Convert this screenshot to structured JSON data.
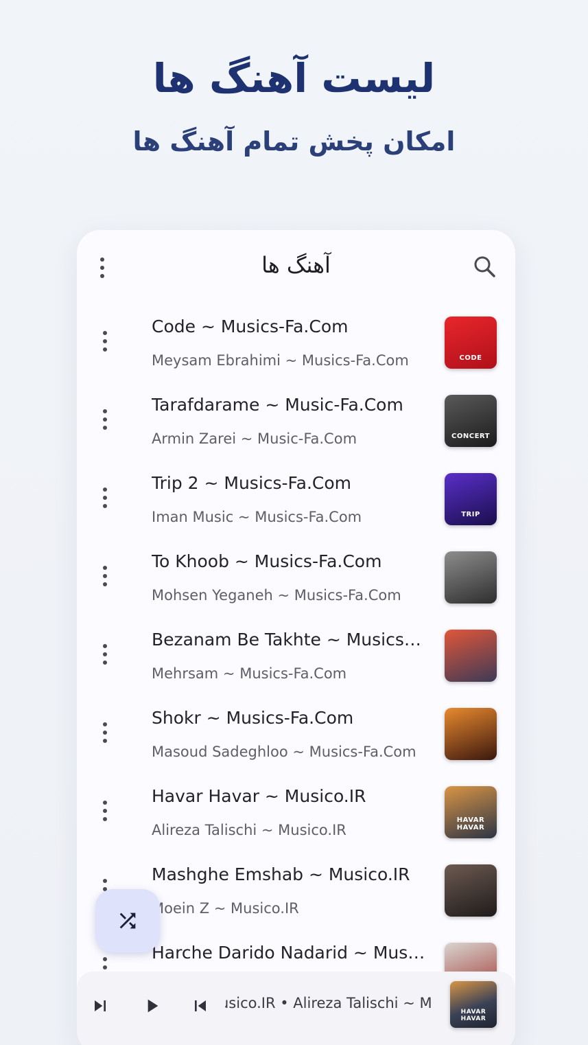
{
  "promo": {
    "title": "لیست آهنگ ها",
    "subtitle": "امکان پخش تمام آهنگ ها"
  },
  "appbar": {
    "title": "آهنگ ها",
    "menu_icon": "more-vert-icon",
    "search_icon": "search-icon"
  },
  "songs": [
    {
      "title": "Code ~ Musics-Fa.Com",
      "artist": "Meysam Ebrahimi ~ Musics-Fa.Com",
      "art_label": "CODE",
      "art_colors": [
        "#e8262b",
        "#b0101a"
      ]
    },
    {
      "title": "Tarafdarame ~ Music-Fa.Com",
      "artist": "Armin Zarei ~ Music-Fa.Com",
      "art_label": "CONCERT",
      "art_colors": [
        "#5a5a5a",
        "#1b1b1b"
      ]
    },
    {
      "title": "Trip 2 ~ Musics-Fa.Com",
      "artist": "Iman Music ~ Musics-Fa.Com",
      "art_label": "TRIP",
      "art_colors": [
        "#5a2ec9",
        "#1a0f4d"
      ]
    },
    {
      "title": "To Khoob ~ Musics-Fa.Com",
      "artist": "Mohsen Yeganeh ~ Musics-Fa.Com",
      "art_label": "",
      "art_colors": [
        "#8d8d8d",
        "#2e2e2e"
      ]
    },
    {
      "title": "Bezanam Be Takhte ~ Musics-Fa.Com",
      "artist": "Mehrsam ~ Musics-Fa.Com",
      "art_label": "",
      "art_colors": [
        "#e0563a",
        "#3d3a56"
      ]
    },
    {
      "title": "Shokr ~ Musics-Fa.Com",
      "artist": "Masoud Sadeghloo ~ Musics-Fa.Com",
      "art_label": "",
      "art_colors": [
        "#e88a2f",
        "#3b170e"
      ]
    },
    {
      "title": "Havar Havar ~ Musico.IR",
      "artist": "Alireza Talischi ~ Musico.IR",
      "art_label": "HAVAR HAVAR",
      "art_colors": [
        "#d99545",
        "#2d3445"
      ]
    },
    {
      "title": "Mashghe Emshab ~ Musico.IR",
      "artist": "Moein Z ~ Musico.IR",
      "art_label": "",
      "art_colors": [
        "#6d5a50",
        "#1e1b1b"
      ]
    },
    {
      "title": "Harche Darido Nadarid ~ Musico.IR",
      "artist": "",
      "art_label": "",
      "art_colors": [
        "#d9d5d0",
        "#a03a36"
      ]
    }
  ],
  "shuffle_button": {
    "icon": "shuffle-icon"
  },
  "player": {
    "now_playing": "usico.IR • Alireza Talischi ~ Musico.IR",
    "next_icon": "skip-next-icon",
    "play_icon": "play-icon",
    "prev_icon": "skip-previous-icon",
    "art_label": "HAVAR HAVAR"
  }
}
